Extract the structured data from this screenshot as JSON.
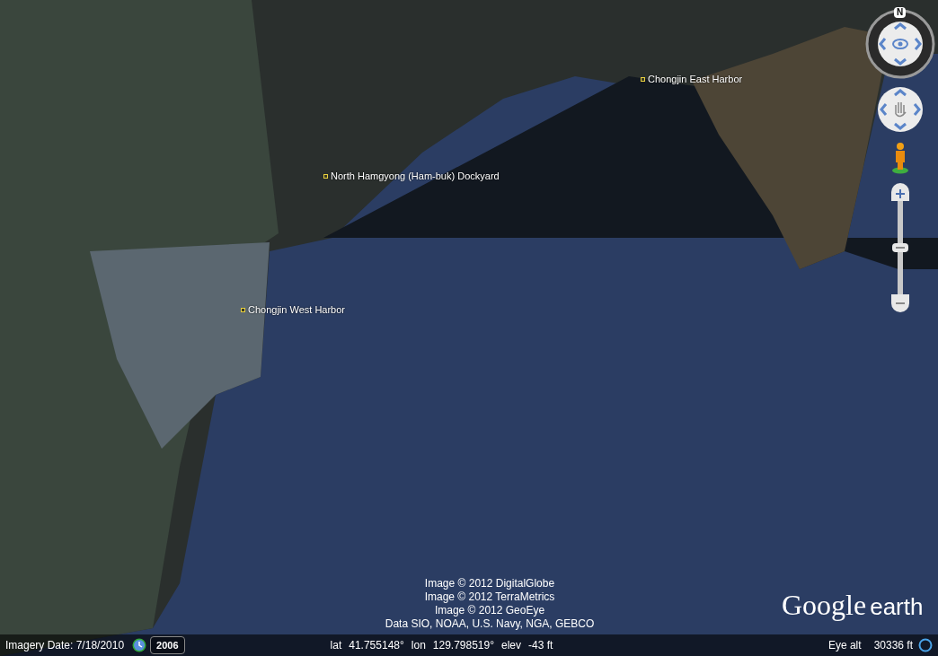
{
  "placemarks": [
    {
      "label": "Chongjin East Harbor"
    },
    {
      "label": "North Hamgyong (Ham-buk) Dockyard"
    },
    {
      "label": "Chongjin West Harbor"
    }
  ],
  "navigation": {
    "compass_label": "N",
    "zoom": {
      "level": 0.5
    }
  },
  "attributions": [
    "Image © 2012 DigitalGlobe",
    "Image © 2012 TerraMetrics",
    "Image © 2012 GeoEye",
    "Data SIO, NOAA, U.S. Navy, NGA, GEBCO"
  ],
  "logo": {
    "brand": "Google",
    "product": "earth"
  },
  "status_bar": {
    "imagery_date": "Imagery Date: 7/18/2010",
    "historical_year": "2006",
    "lat_label": "lat",
    "lat": "41.755148°",
    "lon_label": "lon",
    "lon": "129.798519°",
    "elev_label": "elev",
    "elev": "-43 ft",
    "eye_alt_label": "Eye alt",
    "eye_alt": "30336 ft"
  }
}
